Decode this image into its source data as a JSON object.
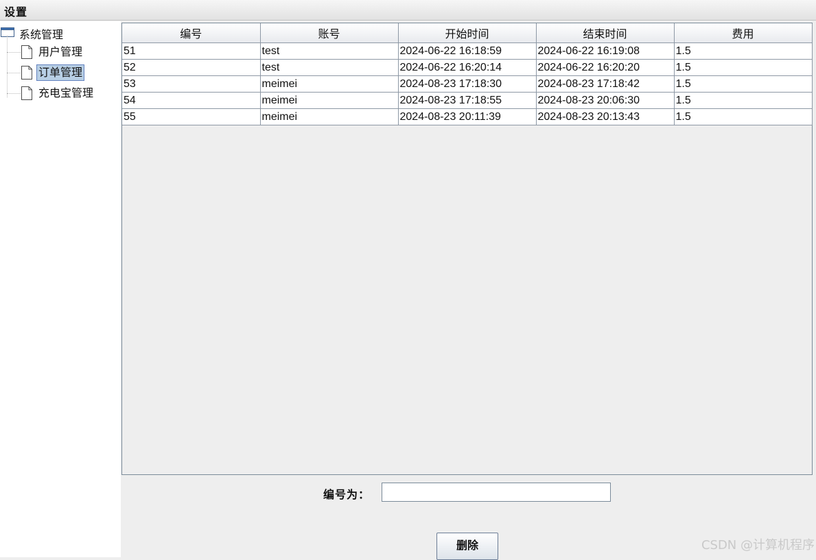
{
  "menubar": {
    "settings_label": "设置"
  },
  "tree": {
    "root_label": "系统管理",
    "items": [
      {
        "label": "用户管理",
        "selected": false
      },
      {
        "label": "订单管理",
        "selected": true
      },
      {
        "label": "充电宝管理",
        "selected": false
      }
    ]
  },
  "table": {
    "columns": [
      "编号",
      "账号",
      "开始时间",
      "结束时间",
      "费用"
    ],
    "rows": [
      [
        "51",
        "test",
        "2024-06-22 16:18:59",
        "2024-06-22 16:19:08",
        "1.5"
      ],
      [
        "52",
        "test",
        "2024-06-22 16:20:14",
        "2024-06-22 16:20:20",
        "1.5"
      ],
      [
        "53",
        "meimei",
        "2024-08-23 17:18:30",
        "2024-08-23 17:18:42",
        "1.5"
      ],
      [
        "54",
        "meimei",
        "2024-08-23 17:18:55",
        "2024-08-23 20:06:30",
        "1.5"
      ],
      [
        "55",
        "meimei",
        "2024-08-23 20:11:39",
        "2024-08-23 20:13:43",
        "1.5"
      ]
    ]
  },
  "form": {
    "id_label": "编号为：",
    "id_value": "",
    "delete_label": "删除"
  },
  "watermark": "CSDN @计算机程序"
}
